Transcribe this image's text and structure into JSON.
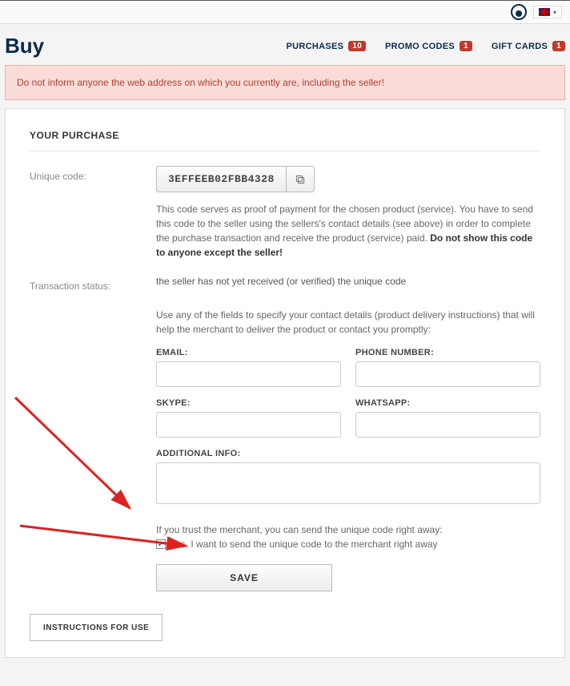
{
  "header": {
    "title": "Buy",
    "tabs": [
      {
        "label": "PURCHASES",
        "badge": "10"
      },
      {
        "label": "PROMO CODES",
        "badge": "1"
      },
      {
        "label": "GIFT CARDS",
        "badge": "1"
      }
    ]
  },
  "warning": "Do not inform anyone the web address on which you currently are, including the seller!",
  "panel": {
    "title": "YOUR PURCHASE",
    "unique_code_label": "Unique code:",
    "unique_code_value": "3EFFEEB02FBB4328",
    "code_desc_1": "This code serves as proof of payment for the chosen product (service). You have to send this code to the seller using the sellers's contact details (see above) in order to complete the purchase transaction and receive the product (service) paid. ",
    "code_desc_bold": "Do not show this code to anyone except the seller!",
    "tx_status_label": "Transaction status:",
    "tx_status_value": "the seller has not yet received (or verified) the unique code",
    "contact_instr": "Use any of the fields to specify your contact details (product delivery instructions) that will help the merchant to deliver the product or contact you promptly:",
    "fields": {
      "email": "EMAIL:",
      "phone": "PHONE NUMBER:",
      "skype": "SKYPE:",
      "whatsapp": "WHATSAPP:",
      "additional": "ADDITIONAL INFO:"
    },
    "trust_text": "If you trust the merchant, you can send the unique code right away:",
    "checkbox_label": "yes, I want to send the unique code to the merchant right away",
    "save_label": "SAVE",
    "instructions_label": "INSTRUCTIONS FOR USE"
  }
}
